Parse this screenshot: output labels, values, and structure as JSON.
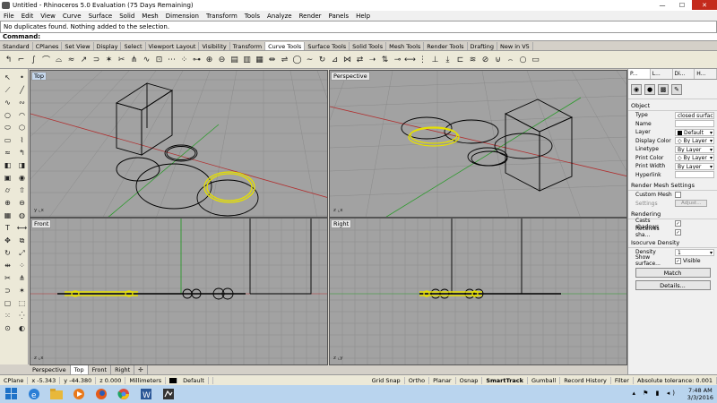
{
  "window": {
    "title": "Untitled - Rhinoceros 5.0 Evaluation (75 Days Remaining)",
    "minimize": "—",
    "maximize": "☐",
    "close": "✕"
  },
  "menu": [
    "File",
    "Edit",
    "View",
    "Curve",
    "Surface",
    "Solid",
    "Mesh",
    "Dimension",
    "Transform",
    "Tools",
    "Analyze",
    "Render",
    "Panels",
    "Help"
  ],
  "command": {
    "history": "No duplicates found. Nothing added to the selection.",
    "prompt": "Command:"
  },
  "toolbar_tabs": [
    "Standard",
    "CPlanes",
    "Set View",
    "Display",
    "Select",
    "Viewport Layout",
    "Visibility",
    "Transform",
    "Curve Tools",
    "Surface Tools",
    "Solid Tools",
    "Mesh Tools",
    "Render Tools",
    "Drafting",
    "New in V5"
  ],
  "active_toolbar_tab": "Curve Tools",
  "viewports": {
    "top": {
      "label": "Top"
    },
    "perspective": {
      "label": "Perspective"
    },
    "front": {
      "label": "Front"
    },
    "right": {
      "label": "Right"
    }
  },
  "viewport_tabs": [
    "Perspective",
    "Top",
    "Front",
    "Right",
    "✢"
  ],
  "status": {
    "cplane": "CPlane",
    "x": "x -5.343",
    "y": "y -44.380",
    "z": "z 0.000",
    "units": "Millimeters",
    "layer": "Default",
    "grid_snap": "Grid Snap",
    "ortho": "Ortho",
    "planar": "Planar",
    "osnap": "Osnap",
    "smarttrack": "SmartTrack",
    "gumball": "Gumball",
    "record_history": "Record History",
    "filter": "Filter",
    "tolerance": "Absolute tolerance: 0.001"
  },
  "panel": {
    "tabs": [
      "P...",
      "L...",
      "Di...",
      "H..."
    ],
    "object_section": "Object",
    "props": [
      {
        "k": "Type",
        "v": "closed surface"
      },
      {
        "k": "Name",
        "v": ""
      },
      {
        "k": "Layer",
        "v": "Default"
      },
      {
        "k": "Display Color",
        "v": "By Layer"
      },
      {
        "k": "Linetype",
        "v": "By Layer"
      },
      {
        "k": "Print Color",
        "v": "By Layer"
      },
      {
        "k": "Print Width",
        "v": "By Layer"
      },
      {
        "k": "Hyperlink",
        "v": ""
      }
    ],
    "mesh_section": "Render Mesh Settings",
    "custom_mesh": "Custom Mesh",
    "settings_label": "Settings",
    "adjust_btn": "Adjust...",
    "rendering_section": "Rendering",
    "casts_shadows": "Casts shadows",
    "receives_shadows": "Receives sha...",
    "isocurve_section": "Isocurve Density",
    "density_label": "Density",
    "density_value": "1",
    "show_surface": "Show surface...",
    "visible": "Visible",
    "match_btn": "Match",
    "details_btn": "Details..."
  },
  "taskbar": {
    "time": "7:48 AM",
    "date": "3/3/2016"
  }
}
